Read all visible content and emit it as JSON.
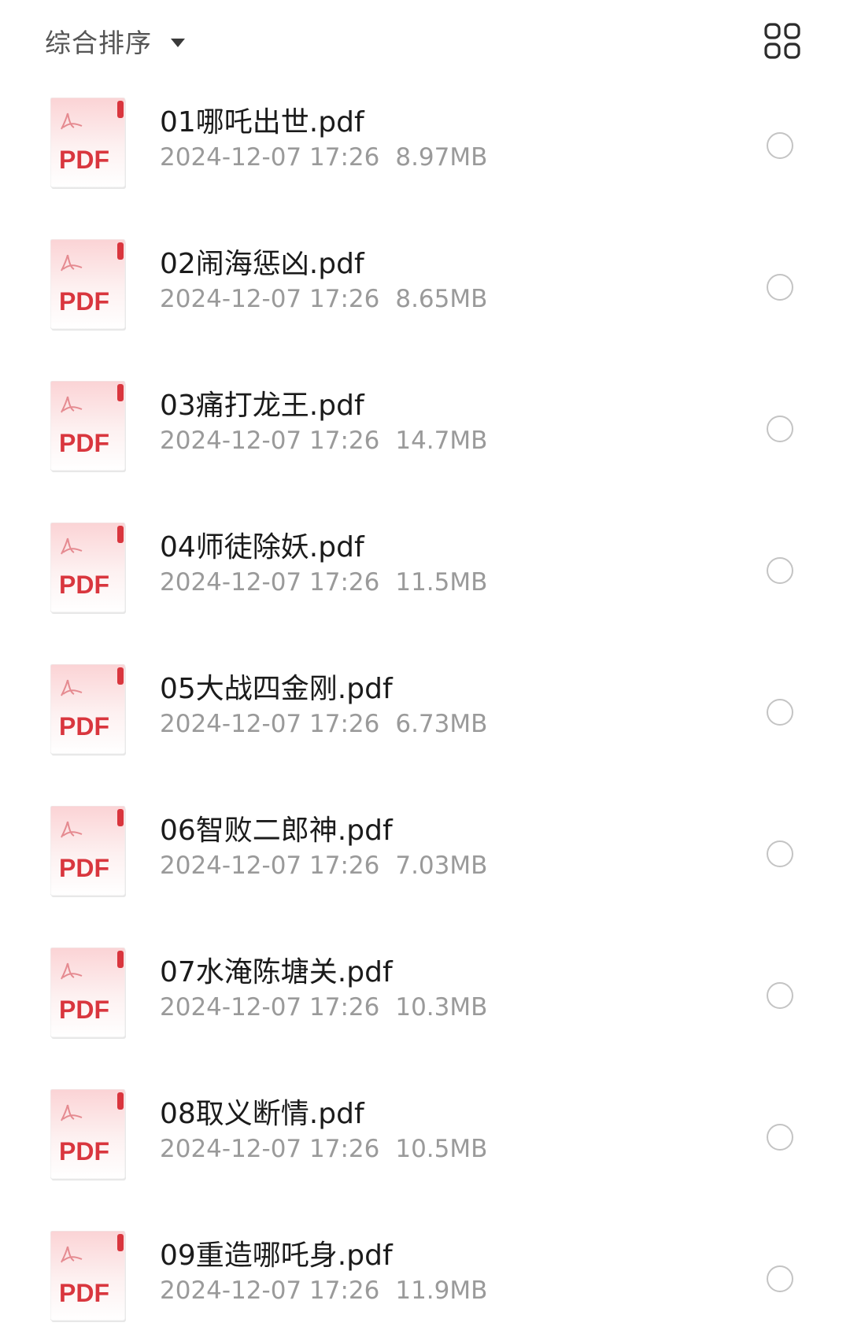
{
  "toolbar": {
    "sort_label": "综合排序",
    "sort_icon": "caret-down-icon",
    "view_toggle_icon": "grid-view-icon"
  },
  "colors": {
    "pdf_red": "#d9363e",
    "selector_border": "#c4c4c4",
    "meta_text": "#9a9a9a"
  },
  "files": [
    {
      "name": "01哪吒出世.pdf",
      "date": "2024-12-07 17:26",
      "size": "8.97MB",
      "type_label": "PDF",
      "selected": false
    },
    {
      "name": "02闹海惩凶.pdf",
      "date": "2024-12-07 17:26",
      "size": "8.65MB",
      "type_label": "PDF",
      "selected": false
    },
    {
      "name": "03痛打龙王.pdf",
      "date": "2024-12-07 17:26",
      "size": "14.7MB",
      "type_label": "PDF",
      "selected": false
    },
    {
      "name": "04师徒除妖.pdf",
      "date": "2024-12-07 17:26",
      "size": "11.5MB",
      "type_label": "PDF",
      "selected": false
    },
    {
      "name": "05大战四金刚.pdf",
      "date": "2024-12-07 17:26",
      "size": "6.73MB",
      "type_label": "PDF",
      "selected": false
    },
    {
      "name": "06智败二郎神.pdf",
      "date": "2024-12-07 17:26",
      "size": "7.03MB",
      "type_label": "PDF",
      "selected": false
    },
    {
      "name": "07水淹陈塘关.pdf",
      "date": "2024-12-07 17:26",
      "size": "10.3MB",
      "type_label": "PDF",
      "selected": false
    },
    {
      "name": "08取义断情.pdf",
      "date": "2024-12-07 17:26",
      "size": "10.5MB",
      "type_label": "PDF",
      "selected": false
    },
    {
      "name": "09重造哪吒身.pdf",
      "date": "2024-12-07 17:26",
      "size": "11.9MB",
      "type_label": "PDF",
      "selected": false
    }
  ]
}
